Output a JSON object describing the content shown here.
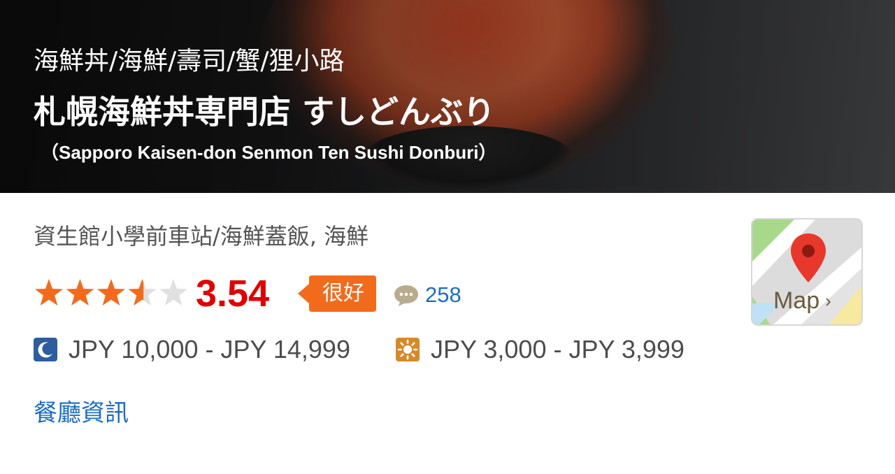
{
  "header": {
    "categories": "海鮮丼/海鮮/壽司/蟹/狸小路",
    "title": "札幌海鮮丼専門店 すしどんぶり",
    "subtitle": "（Sapporo Kaisen-don Senmon Ten Sushi Donburi）"
  },
  "info": {
    "station_cuisine": "資生館小學前車站/海鮮蓋飯, 海鮮"
  },
  "rating": {
    "score": "3.54",
    "stars_value": 3.54,
    "stars_max": 5,
    "badge": "很好",
    "review_count": "258"
  },
  "prices": {
    "dinner_icon": "moon-icon",
    "dinner": "JPY 10,000 - JPY 14,999",
    "lunch_icon": "sun-icon",
    "lunch": "JPY 3,000 - JPY 3,999"
  },
  "links": {
    "restaurant_info": "餐廳資訊"
  },
  "map": {
    "label": "Map",
    "icon": "map-pin-icon"
  },
  "colors": {
    "star_filled": "#f26b1d",
    "star_empty": "#e0e0e0",
    "score": "#e00000",
    "badge": "#f26b1d",
    "link": "#1a6dc5",
    "dinner_icon_bg": "#2e5d9f",
    "lunch_icon_bg": "#d48a2b"
  }
}
